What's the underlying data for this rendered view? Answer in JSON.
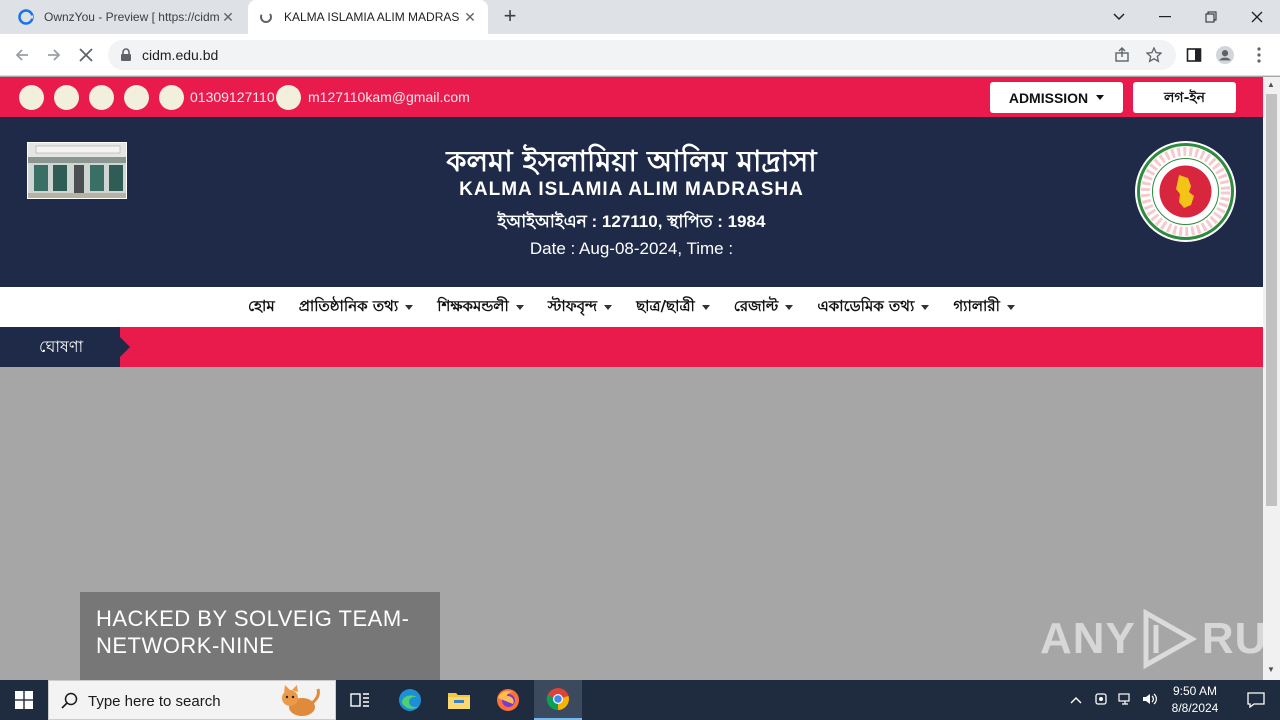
{
  "browser": {
    "tabs": [
      {
        "title": "OwnzYou - Preview [ https://cidm",
        "active": false
      },
      {
        "title": "KALMA ISLAMIA ALIM MADRAS",
        "active": true
      }
    ],
    "url": "cidm.edu.bd"
  },
  "topbar": {
    "phone": "01309127110",
    "email": "m127110kam@gmail.com",
    "admission_label": "ADMISSION",
    "login_label": "লগ-ইন"
  },
  "header": {
    "title_bn": "কলমা ইসলামিয়া আলিম মাদ্রাসা",
    "title_en": "KALMA ISLAMIA ALIM MADRASHA",
    "eiin": "ইআইআইএন : 127110, স্থাপিত : 1984",
    "date": "Date : Aug-08-2024, Time :",
    "emblem_text_top": "গণপ্রজাতন্ত্রী বাংলাদেশ",
    "emblem_text_bottom": "সরকার"
  },
  "menu": [
    {
      "label": "হোম",
      "dropdown": false
    },
    {
      "label": "প্রাতিষ্ঠানিক তথ্য",
      "dropdown": true
    },
    {
      "label": "শিক্ষকমন্ডলী",
      "dropdown": true
    },
    {
      "label": "স্টাফবৃন্দ",
      "dropdown": true
    },
    {
      "label": "ছাত্র/ছাত্রী",
      "dropdown": true
    },
    {
      "label": "রেজাল্ট",
      "dropdown": true
    },
    {
      "label": "একাডেমিক তথ্য",
      "dropdown": true
    },
    {
      "label": "গ্যালারী",
      "dropdown": true
    }
  ],
  "notice": {
    "label": "ঘোষণা"
  },
  "overlay": {
    "hacked_text": "HACKED BY SOLVEIG TEAM-NETWORK-NINE"
  },
  "watermark": {
    "text": "ANY RUN"
  },
  "taskbar": {
    "search_placeholder": "Type here to search",
    "time": "9:50 AM",
    "date": "8/8/2024"
  },
  "colors": {
    "accent": "#e91b4d",
    "navy": "#1e2a47",
    "background": "#a6a6a6"
  }
}
